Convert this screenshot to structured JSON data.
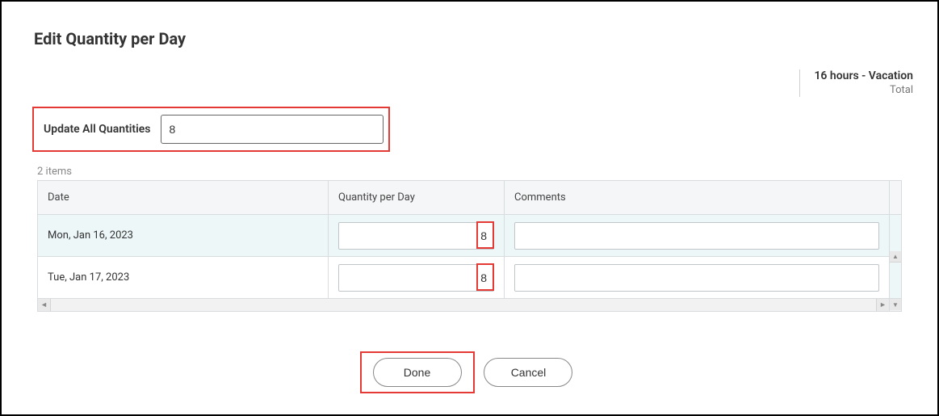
{
  "title": "Edit Quantity per Day",
  "summary": {
    "line1": "16 hours - Vacation",
    "line2": "Total"
  },
  "update": {
    "label": "Update All Quantities",
    "value": "8"
  },
  "items_count": "2 items",
  "table": {
    "headers": {
      "date": "Date",
      "qty": "Quantity per Day",
      "comments": "Comments"
    },
    "rows": [
      {
        "date": "Mon, Jan 16, 2023",
        "qty": "8",
        "comment": ""
      },
      {
        "date": "Tue, Jan 17, 2023",
        "qty": "8",
        "comment": ""
      }
    ]
  },
  "buttons": {
    "done": "Done",
    "cancel": "Cancel"
  }
}
